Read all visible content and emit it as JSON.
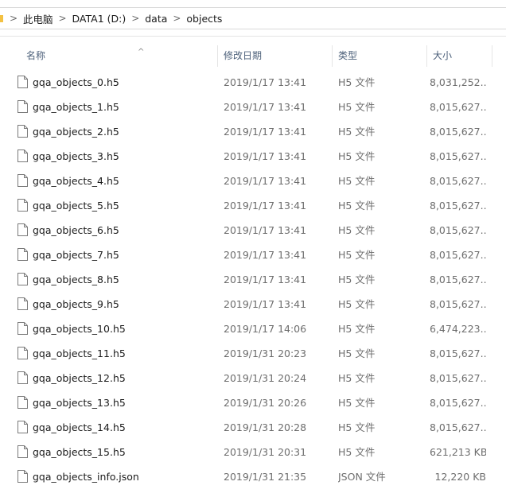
{
  "breadcrumb": {
    "items": [
      {
        "label": "此电脑"
      },
      {
        "label": "DATA1 (D:)"
      },
      {
        "label": "data"
      },
      {
        "label": "objects"
      }
    ],
    "separator": ">"
  },
  "columns": {
    "name": "名称",
    "date": "修改日期",
    "type": "类型",
    "size": "大小",
    "sort_icon": "^"
  },
  "files": [
    {
      "name": "gqa_objects_0.h5",
      "date": "2019/1/17 13:41",
      "type": "H5 文件",
      "size": "8,031,252..."
    },
    {
      "name": "gqa_objects_1.h5",
      "date": "2019/1/17 13:41",
      "type": "H5 文件",
      "size": "8,015,627..."
    },
    {
      "name": "gqa_objects_2.h5",
      "date": "2019/1/17 13:41",
      "type": "H5 文件",
      "size": "8,015,627..."
    },
    {
      "name": "gqa_objects_3.h5",
      "date": "2019/1/17 13:41",
      "type": "H5 文件",
      "size": "8,015,627..."
    },
    {
      "name": "gqa_objects_4.h5",
      "date": "2019/1/17 13:41",
      "type": "H5 文件",
      "size": "8,015,627..."
    },
    {
      "name": "gqa_objects_5.h5",
      "date": "2019/1/17 13:41",
      "type": "H5 文件",
      "size": "8,015,627..."
    },
    {
      "name": "gqa_objects_6.h5",
      "date": "2019/1/17 13:41",
      "type": "H5 文件",
      "size": "8,015,627..."
    },
    {
      "name": "gqa_objects_7.h5",
      "date": "2019/1/17 13:41",
      "type": "H5 文件",
      "size": "8,015,627..."
    },
    {
      "name": "gqa_objects_8.h5",
      "date": "2019/1/17 13:41",
      "type": "H5 文件",
      "size": "8,015,627..."
    },
    {
      "name": "gqa_objects_9.h5",
      "date": "2019/1/17 13:41",
      "type": "H5 文件",
      "size": "8,015,627..."
    },
    {
      "name": "gqa_objects_10.h5",
      "date": "2019/1/17 14:06",
      "type": "H5 文件",
      "size": "6,474,223..."
    },
    {
      "name": "gqa_objects_11.h5",
      "date": "2019/1/31 20:23",
      "type": "H5 文件",
      "size": "8,015,627..."
    },
    {
      "name": "gqa_objects_12.h5",
      "date": "2019/1/31 20:24",
      "type": "H5 文件",
      "size": "8,015,627..."
    },
    {
      "name": "gqa_objects_13.h5",
      "date": "2019/1/31 20:26",
      "type": "H5 文件",
      "size": "8,015,627..."
    },
    {
      "name": "gqa_objects_14.h5",
      "date": "2019/1/31 20:28",
      "type": "H5 文件",
      "size": "8,015,627..."
    },
    {
      "name": "gqa_objects_15.h5",
      "date": "2019/1/31 20:31",
      "type": "H5 文件",
      "size": "621,213 KB"
    },
    {
      "name": "gqa_objects_info.json",
      "date": "2019/1/31 21:35",
      "type": "JSON 文件",
      "size": "12,220 KB"
    }
  ]
}
